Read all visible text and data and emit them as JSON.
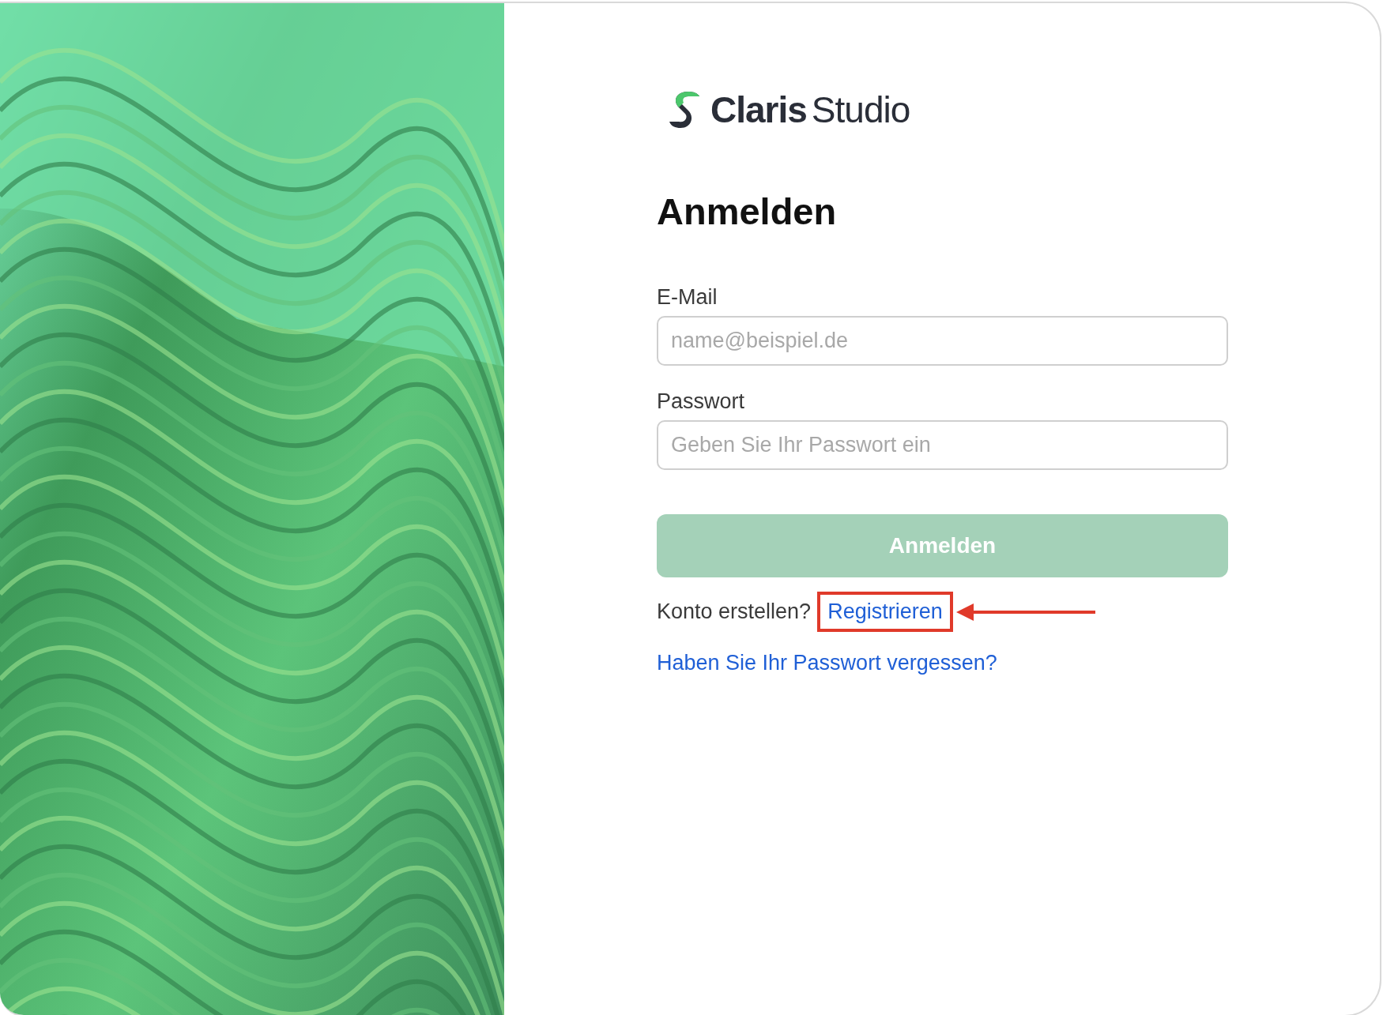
{
  "logo": {
    "brand": "Claris",
    "product": "Studio"
  },
  "heading": "Anmelden",
  "fields": [
    {
      "label": "E-Mail",
      "placeholder": "name@beispiel.de"
    },
    {
      "label": "Passwort",
      "placeholder": "Geben Sie Ihr Passwort ein"
    }
  ],
  "submit": {
    "label": "Anmelden",
    "disabled": true
  },
  "signup": {
    "prompt": "Konto erstellen?",
    "link": "Registrieren",
    "highlighted": true
  },
  "forgot_link": "Haben Sie Ihr Passwort vergessen?"
}
